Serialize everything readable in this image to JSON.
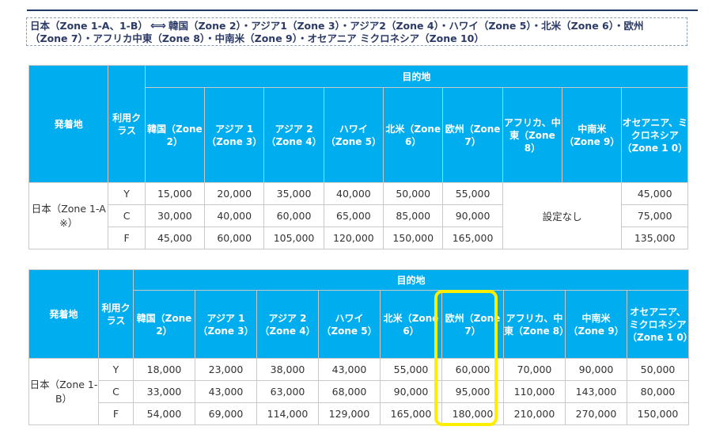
{
  "zone_note": {
    "part1": "日本（Zone 1-A、1-B）",
    "part2": "韓国（Zone 2）・アジア1（Zone 3）・アジア2（Zone 4）・ハワイ（Zone 5）・北米（Zone 6）・欧州",
    "line2": "（Zone 7）・アフリカ中東（Zone 8）・中南米（Zone 9）・オセアニア ミクロネシア（Zone 10）"
  },
  "table1": {
    "origin_header": "発着地",
    "class_header": "利用クラス",
    "dest_header": "目的地",
    "destinations": [
      "韓国（Zone 2）",
      "アジア 1（Zone 3）",
      "アジア 2（Zone 4）",
      "ハワイ（Zone 5）",
      "北米（Zone 6）",
      "欧州（Zone 7）",
      "アフリカ、中東（Zone 8）",
      "中南米（Zone 9）",
      "オセアニア、ミクロネシア（Zone 1 0）"
    ],
    "origin": "日本（Zone 1-A ※）",
    "not_set": "設定なし",
    "rows": [
      {
        "class": "Y",
        "values": [
          "15,000",
          "20,000",
          "35,000",
          "40,000",
          "50,000",
          "55,000",
          "45,000"
        ]
      },
      {
        "class": "C",
        "values": [
          "30,000",
          "40,000",
          "60,000",
          "65,000",
          "85,000",
          "90,000",
          "75,000"
        ]
      },
      {
        "class": "F",
        "values": [
          "45,000",
          "60,000",
          "105,000",
          "120,000",
          "150,000",
          "165,000",
          "135,000"
        ]
      }
    ]
  },
  "table2": {
    "origin_header": "発着地",
    "class_header": "利用クラス",
    "dest_header": "目的地",
    "destinations": [
      "韓国（Zone 2）",
      "アジア 1（Zone 3）",
      "アジア 2（Zone 4）",
      "ハワイ（Zone 5）",
      "北米（Zone 6）",
      "欧州（Zone 7）",
      "アフリカ、中東（Zone 8）",
      "中南米（Zone 9）",
      "オセアニア、ミクロネシア（Zone 1 0）"
    ],
    "origin": "日本（Zone 1-B）",
    "rows": [
      {
        "class": "Y",
        "values": [
          "18,000",
          "23,000",
          "38,000",
          "43,000",
          "55,000",
          "60,000",
          "70,000",
          "90,000",
          "50,000"
        ]
      },
      {
        "class": "C",
        "values": [
          "33,000",
          "43,000",
          "63,000",
          "68,000",
          "90,000",
          "95,000",
          "110,000",
          "143,000",
          "80,000"
        ]
      },
      {
        "class": "F",
        "values": [
          "54,000",
          "69,000",
          "114,000",
          "129,000",
          "165,000",
          "180,000",
          "210,000",
          "270,000",
          "150,000"
        ]
      }
    ]
  },
  "colors": {
    "header_bg": "#00aef0",
    "highlight": "#ffee00"
  }
}
